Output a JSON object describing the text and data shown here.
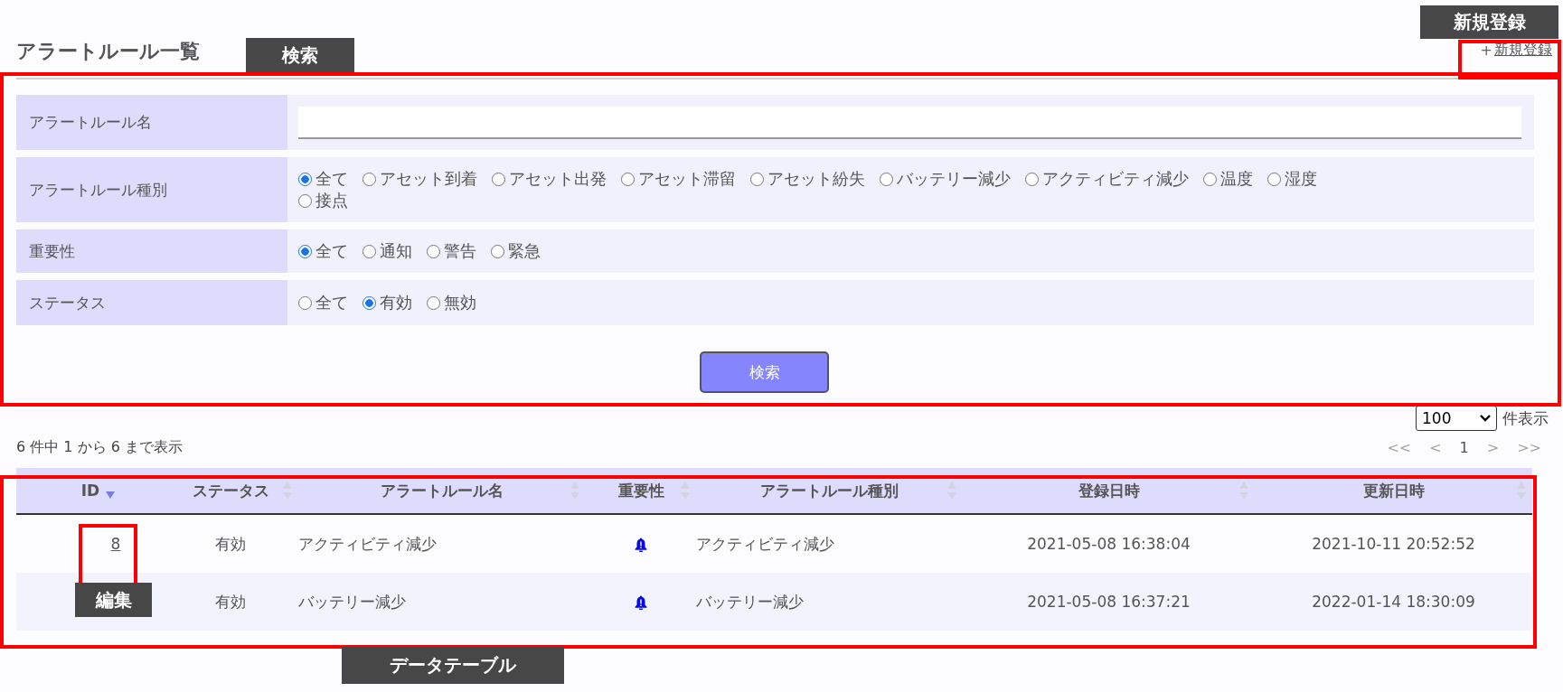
{
  "page_title": "アラートルール一覧",
  "new_link": {
    "plus": "+",
    "label": "新規登録"
  },
  "search_form": {
    "rows": [
      {
        "kind": "text",
        "label": "アラートルール名",
        "value": ""
      },
      {
        "kind": "radio",
        "label": "アラートルール種別",
        "options": [
          {
            "label": "全て",
            "selected": true
          },
          {
            "label": "アセット到着",
            "selected": false
          },
          {
            "label": "アセット出発",
            "selected": false
          },
          {
            "label": "アセット滞留",
            "selected": false
          },
          {
            "label": "アセット紛失",
            "selected": false
          },
          {
            "label": "バッテリー減少",
            "selected": false
          },
          {
            "label": "アクティビティ減少",
            "selected": false
          },
          {
            "label": "温度",
            "selected": false
          },
          {
            "label": "湿度",
            "selected": false
          },
          {
            "label": "接点",
            "selected": false
          }
        ]
      },
      {
        "kind": "radio",
        "label": "重要性",
        "options": [
          {
            "label": "全て",
            "selected": true
          },
          {
            "label": "通知",
            "selected": false
          },
          {
            "label": "警告",
            "selected": false
          },
          {
            "label": "緊急",
            "selected": false
          }
        ]
      },
      {
        "kind": "radio",
        "label": "ステータス",
        "options": [
          {
            "label": "全て",
            "selected": false
          },
          {
            "label": "有効",
            "selected": true
          },
          {
            "label": "無効",
            "selected": false
          }
        ]
      }
    ],
    "button": "検索"
  },
  "page_size": {
    "value": "100",
    "suffix": "件表示"
  },
  "summary": "6 件中 1 から 6 まで表示",
  "pagination": [
    {
      "label": "<<",
      "disabled": true
    },
    {
      "label": "<",
      "disabled": true
    },
    {
      "label": "1",
      "disabled": false
    },
    {
      "label": ">",
      "disabled": true
    },
    {
      "label": ">>",
      "disabled": true
    }
  ],
  "table": {
    "columns": [
      {
        "label": "ID",
        "sorted": true
      },
      {
        "label": "ステータス",
        "sorted": false
      },
      {
        "label": "アラートルール名",
        "sorted": false
      },
      {
        "label": "重要性",
        "sorted": false
      },
      {
        "label": "アラートルール種別",
        "sorted": false
      },
      {
        "label": "登録日時",
        "sorted": false
      },
      {
        "label": "更新日時",
        "sorted": false
      }
    ],
    "rows": [
      {
        "id": "8",
        "status": "有効",
        "name": "アクティビティ減少",
        "type": "アクティビティ減少",
        "created": "2021-05-08 16:38:04",
        "updated": "2021-10-11 20:52:52"
      },
      {
        "status": "有効",
        "name": "バッテリー減少",
        "type": "バッテリー減少",
        "created": "2021-05-08 16:37:21",
        "updated": "2022-01-14 18:30:09"
      }
    ]
  },
  "annotations": [
    {
      "kind": "search",
      "label": "検索"
    },
    {
      "kind": "new",
      "label": "新規登録"
    },
    {
      "kind": "edit",
      "label": "編集"
    },
    {
      "kind": "table",
      "label": "データテーブル"
    }
  ]
}
